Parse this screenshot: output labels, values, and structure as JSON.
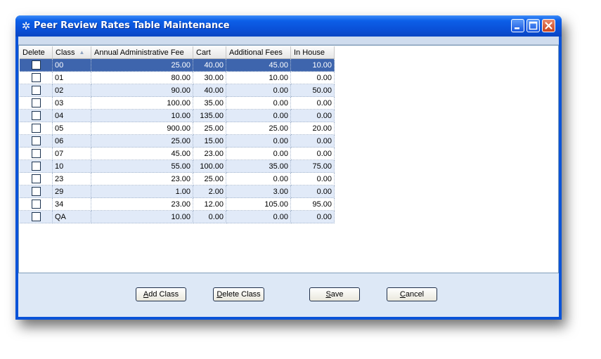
{
  "window": {
    "title": "Peer Review Rates Table Maintenance",
    "icon": "gear-icon",
    "controls": [
      "minimize-icon",
      "maximize-icon",
      "close-icon"
    ]
  },
  "grid": {
    "columns": [
      "Delete",
      "Class",
      "Annual Administrative Fee",
      "Cart",
      "Additional Fees",
      "In House"
    ],
    "sort_column": "Class",
    "sort_direction": "ascending",
    "selected_row": 0,
    "rows": [
      {
        "delete": false,
        "class": "00",
        "admin_fee": "25.00",
        "cart": "40.00",
        "additional": "45.00",
        "in_house": "10.00"
      },
      {
        "delete": false,
        "class": "01",
        "admin_fee": "80.00",
        "cart": "30.00",
        "additional": "10.00",
        "in_house": "0.00"
      },
      {
        "delete": false,
        "class": "02",
        "admin_fee": "90.00",
        "cart": "40.00",
        "additional": "0.00",
        "in_house": "50.00"
      },
      {
        "delete": false,
        "class": "03",
        "admin_fee": "100.00",
        "cart": "35.00",
        "additional": "0.00",
        "in_house": "0.00"
      },
      {
        "delete": false,
        "class": "04",
        "admin_fee": "10.00",
        "cart": "135.00",
        "additional": "0.00",
        "in_house": "0.00"
      },
      {
        "delete": false,
        "class": "05",
        "admin_fee": "900.00",
        "cart": "25.00",
        "additional": "25.00",
        "in_house": "20.00"
      },
      {
        "delete": false,
        "class": "06",
        "admin_fee": "25.00",
        "cart": "15.00",
        "additional": "0.00",
        "in_house": "0.00"
      },
      {
        "delete": false,
        "class": "07",
        "admin_fee": "45.00",
        "cart": "23.00",
        "additional": "0.00",
        "in_house": "0.00"
      },
      {
        "delete": false,
        "class": "10",
        "admin_fee": "55.00",
        "cart": "100.00",
        "additional": "35.00",
        "in_house": "75.00"
      },
      {
        "delete": false,
        "class": "23",
        "admin_fee": "23.00",
        "cart": "25.00",
        "additional": "0.00",
        "in_house": "0.00"
      },
      {
        "delete": false,
        "class": "29",
        "admin_fee": "1.00",
        "cart": "2.00",
        "additional": "3.00",
        "in_house": "0.00"
      },
      {
        "delete": false,
        "class": "34",
        "admin_fee": "23.00",
        "cart": "12.00",
        "additional": "105.00",
        "in_house": "95.00"
      },
      {
        "delete": false,
        "class": "QA",
        "admin_fee": "10.00",
        "cart": "0.00",
        "additional": "0.00",
        "in_house": "0.00"
      }
    ]
  },
  "buttons": {
    "add_class": {
      "first": "A",
      "rest": "dd Class"
    },
    "delete_class": {
      "first": "D",
      "rest": "elete Class"
    },
    "save": {
      "first": "S",
      "rest": "ave"
    },
    "cancel": {
      "first": "C",
      "rest": "ancel"
    }
  },
  "colors": {
    "titlebar": "#0a53d8",
    "selected_row": "#3e65ad",
    "alt_row": "#e1eaf8",
    "panel": "#dde8f6"
  }
}
